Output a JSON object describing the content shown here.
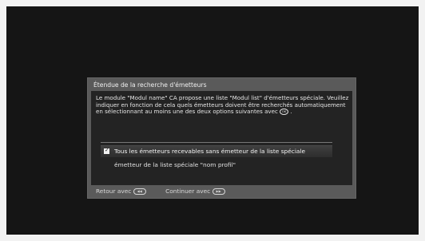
{
  "dialog": {
    "title": "Étendue de la recherche d'émetteurs",
    "description": "Le module \"Modul name\" CA propose une liste \"Modul list\" d'émetteurs spéciale. Veuillez indiquer en fonction de cela quels émetteurs doivent être recherchés automatiquement en sélectionnant au moins une des deux options suivantes avec",
    "description_end": ".",
    "ok_icon": "ok-button-icon",
    "options": [
      {
        "label": "Tous les émetteurs recevables sans émetteur de la liste spéciale",
        "checked": true,
        "selected": true
      },
      {
        "label": "émetteur de la liste spéciale \"nom profil\"",
        "checked": false,
        "selected": false
      }
    ]
  },
  "footer": {
    "back_label": "Retour avec",
    "back_icon": "rewind-key-icon",
    "continue_label": "Continuer avec",
    "continue_icon": "forward-key-icon"
  },
  "colors": {
    "screen_bg": "#151515",
    "dialog_frame": "#5a5a5a",
    "dialog_inner": "#232323"
  }
}
